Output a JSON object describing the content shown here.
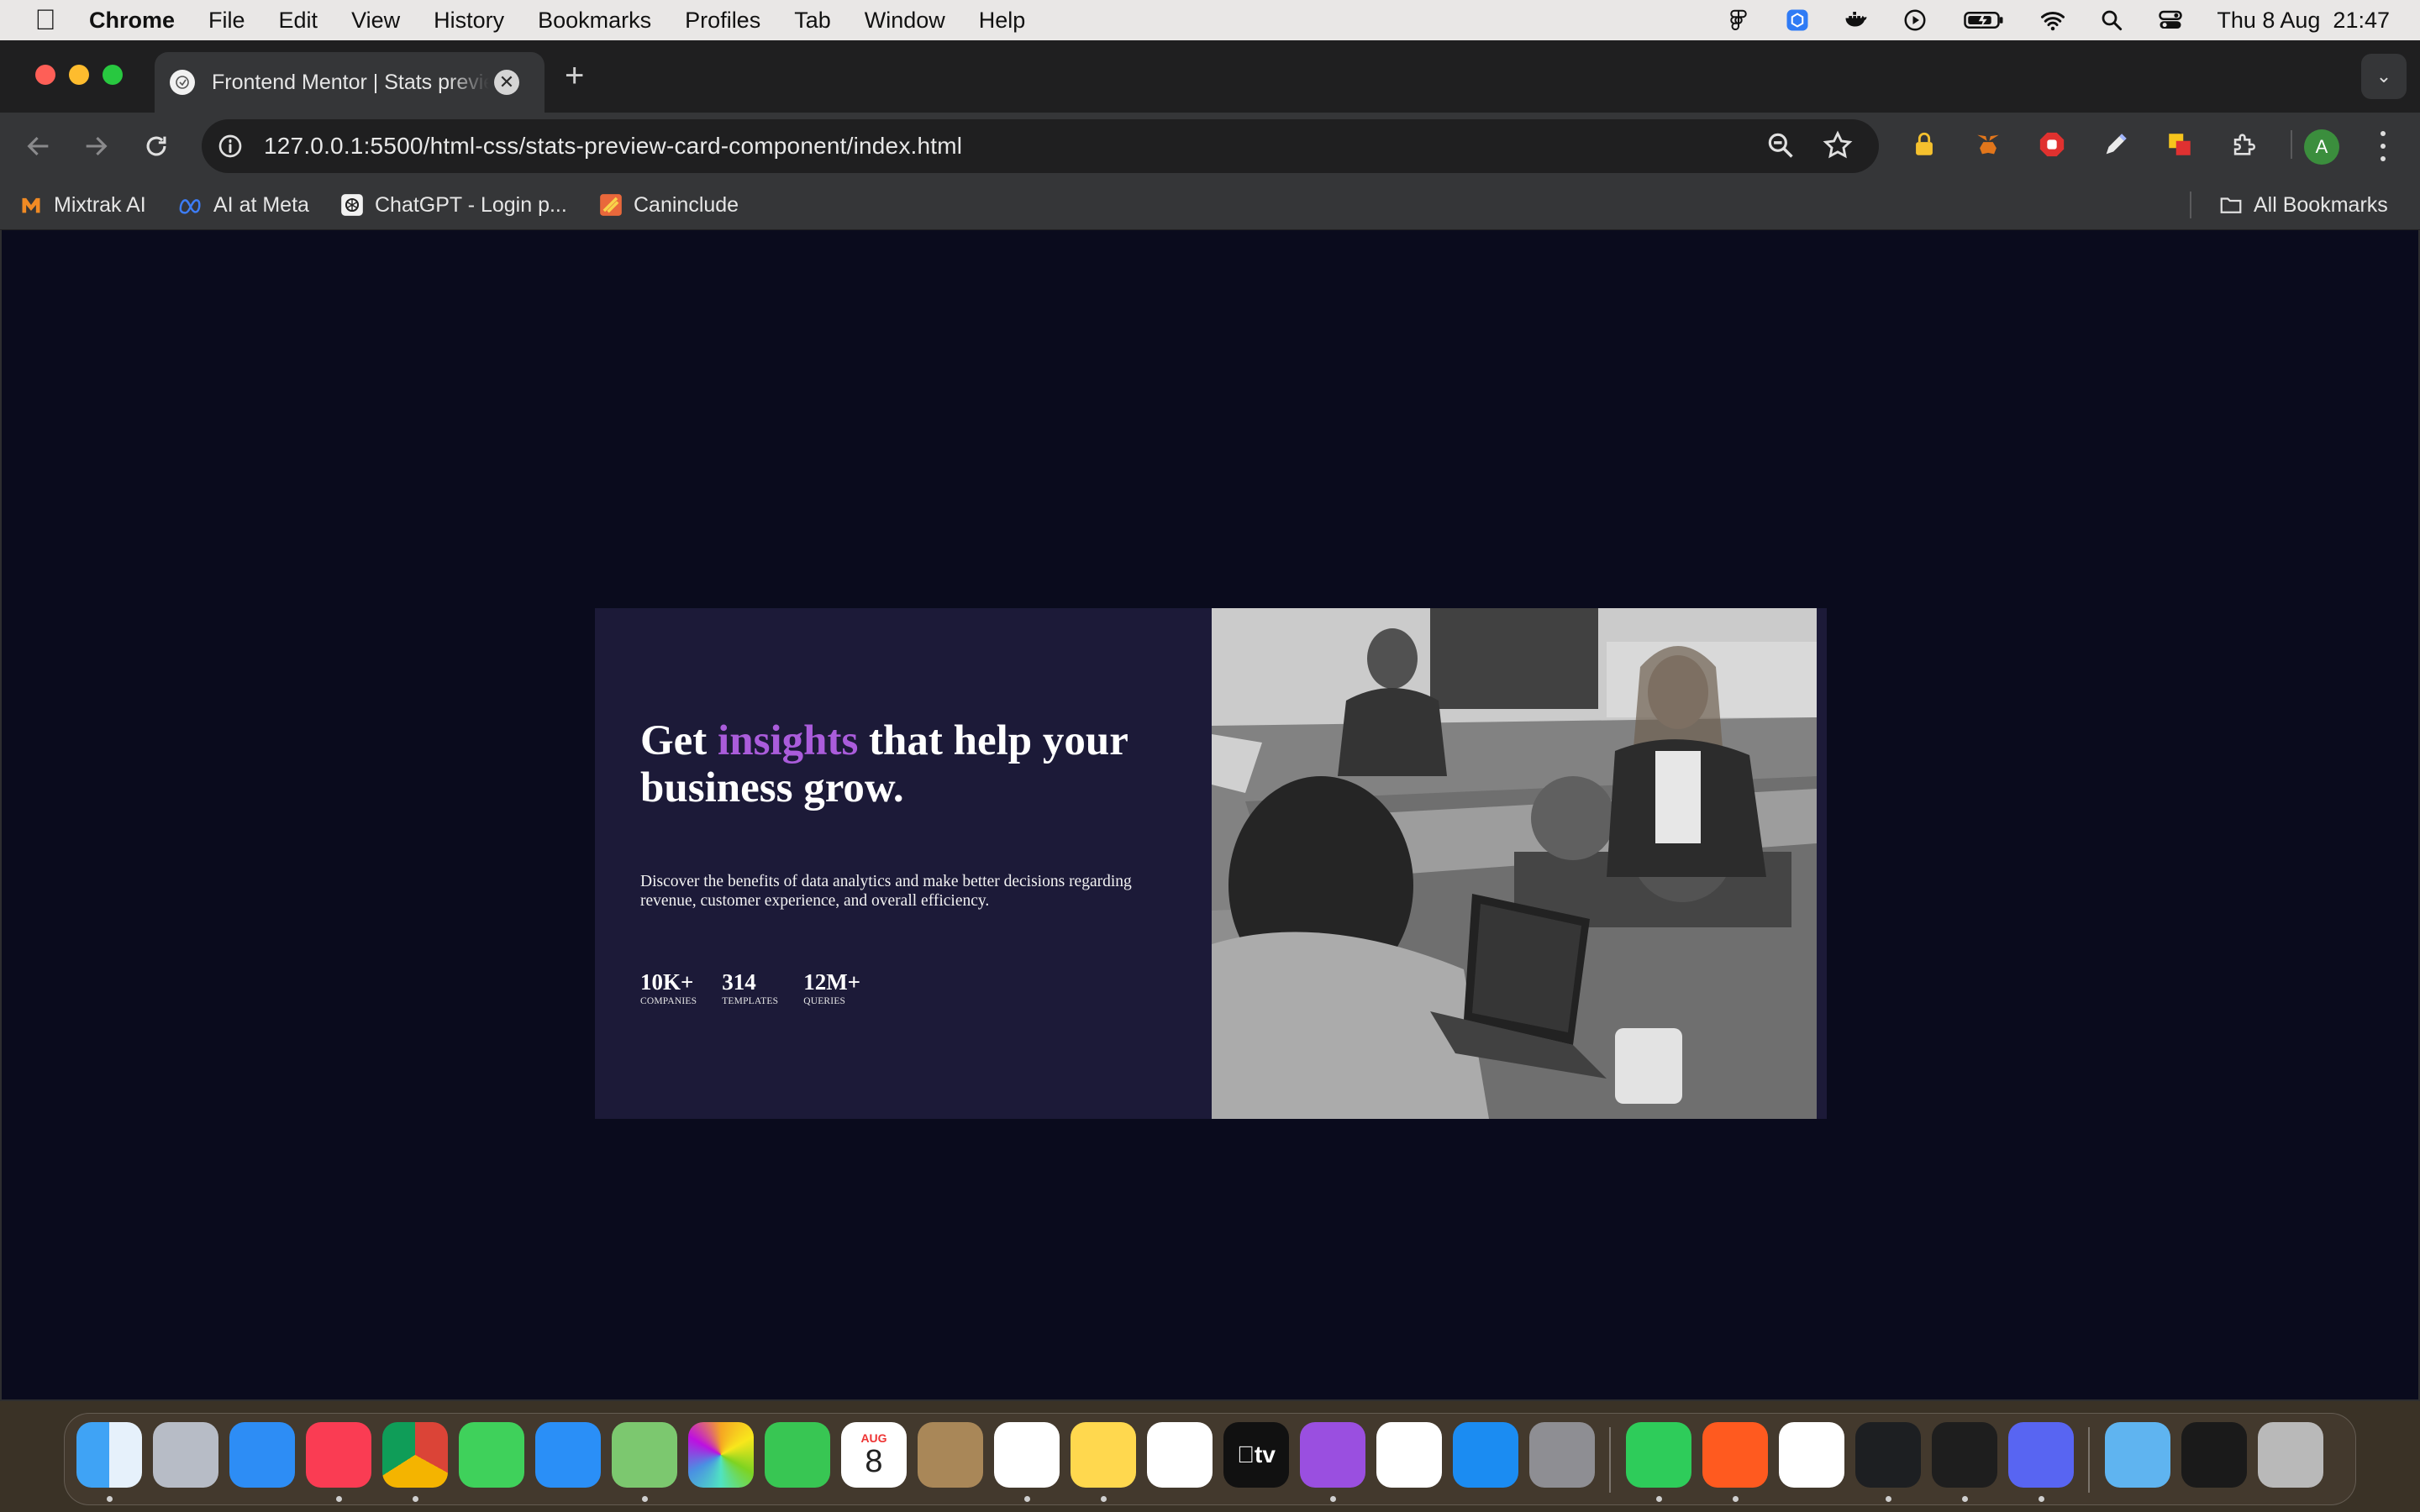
{
  "menubar": {
    "app_name": "Chrome",
    "items": [
      "File",
      "Edit",
      "View",
      "History",
      "Bookmarks",
      "Profiles",
      "Tab",
      "Window",
      "Help"
    ],
    "clock": "Thu 8 Aug  21:47",
    "status_icons": [
      "figma-menubar-icon",
      "vpn-icon",
      "docker-icon",
      "play-icon",
      "battery-icon",
      "wifi-icon",
      "spotlight-icon",
      "control-center-icon"
    ]
  },
  "browser": {
    "tab_title": "Frontend Mentor | Stats preview card component",
    "url": "127.0.0.1:5500/html-css/stats-preview-card-component/index.html",
    "avatar_letter": "A",
    "bookmarks": [
      {
        "label": "Mixtrak AI",
        "icon": "mixtrak-icon"
      },
      {
        "label": "AI at Meta",
        "icon": "meta-icon"
      },
      {
        "label": "ChatGPT - Login p...",
        "icon": "chatgpt-icon"
      },
      {
        "label": "Caninclude",
        "icon": "caninclude-icon"
      }
    ],
    "all_bookmarks": "All Bookmarks"
  },
  "card": {
    "title_prefix": "Get ",
    "title_accent": "insights",
    "title_suffix": " that help your business grow.",
    "description": "Discover the benefits of data analytics and make better decisions regarding revenue, customer experience, and overall efficiency.",
    "stats": [
      {
        "value": "10K+",
        "label": "Companies"
      },
      {
        "value": "314",
        "label": "Templates"
      },
      {
        "value": "12M+",
        "label": "Queries"
      }
    ],
    "colors": {
      "background": "#0a0b1d",
      "card": "#1c1a38",
      "accent": "#aa5cdb"
    }
  },
  "dock": {
    "apps": [
      "finder-icon",
      "launchpad-icon",
      "safari-icon",
      "music-icon",
      "chrome-icon",
      "messages-icon",
      "mail-icon",
      "maps-icon",
      "photos-icon",
      "facetime-icon",
      "calendar-icon",
      "contacts-icon",
      "reminders-icon",
      "notes-icon",
      "freeform-icon",
      "apple-tv-icon",
      "podcasts-icon",
      "news-icon",
      "app-store-icon",
      "system-settings-icon",
      "whatsapp-icon",
      "brave-icon",
      "vscode-icon",
      "activity-monitor-icon",
      "figma-icon",
      "discord-icon",
      "downloads-folder-icon",
      "recent-app-icon",
      "trash-icon"
    ],
    "calendar_month": "AUG",
    "calendar_day": "8",
    "tv_label": "tv"
  }
}
